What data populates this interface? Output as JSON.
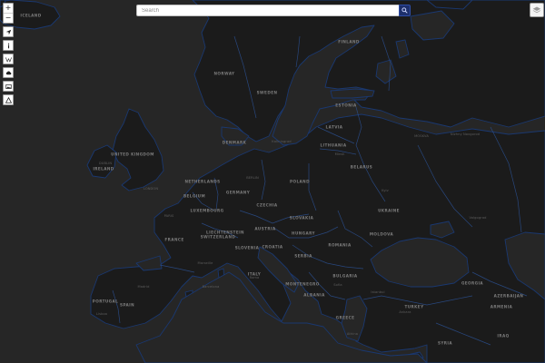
{
  "search": {
    "placeholder": "Search"
  },
  "toolbar": {
    "zoom_in": "+",
    "zoom_out": "−",
    "buttons": [
      {
        "icon": "navigation-arrow-icon"
      },
      {
        "icon": "info-icon"
      },
      {
        "icon": "wikipedia-icon"
      },
      {
        "icon": "weather-cloud-icon"
      },
      {
        "icon": "image-icon"
      },
      {
        "icon": "triangle-warning-icon"
      }
    ]
  },
  "layers": {
    "icon": "layers-icon"
  },
  "colors": {
    "land": "#1b1b1b",
    "sea": "#262626",
    "border": "#2b4f8f",
    "coast": "#1a3870",
    "accent": "#1d2f6b"
  },
  "map": {
    "labels": [
      {
        "text": "ICELAND",
        "kind": "country"
      },
      {
        "text": "FINLAND",
        "kind": "country"
      },
      {
        "text": "NORWAY",
        "kind": "country"
      },
      {
        "text": "SWEDEN",
        "kind": "country"
      },
      {
        "text": "ESTONIA",
        "kind": "country"
      },
      {
        "text": "LATVIA",
        "kind": "country"
      },
      {
        "text": "LITHUANIA",
        "kind": "country"
      },
      {
        "text": "UNITED KINGDOM",
        "kind": "country"
      },
      {
        "text": "IRELAND",
        "kind": "country"
      },
      {
        "text": "DENMARK",
        "kind": "country"
      },
      {
        "text": "POLAND",
        "kind": "country"
      },
      {
        "text": "BELARUS",
        "kind": "country"
      },
      {
        "text": "GERMANY",
        "kind": "country"
      },
      {
        "text": "NETHERLANDS",
        "kind": "country"
      },
      {
        "text": "BELGIUM",
        "kind": "country"
      },
      {
        "text": "LUXEMBOURG",
        "kind": "country"
      },
      {
        "text": "FRANCE",
        "kind": "country"
      },
      {
        "text": "SWITZERLAND",
        "kind": "country"
      },
      {
        "text": "LIECHTENSTEIN",
        "kind": "country"
      },
      {
        "text": "AUSTRIA",
        "kind": "country"
      },
      {
        "text": "CZECHIA",
        "kind": "country"
      },
      {
        "text": "SLOVAKIA",
        "kind": "country"
      },
      {
        "text": "HUNGARY",
        "kind": "country"
      },
      {
        "text": "SLOVENIA",
        "kind": "country"
      },
      {
        "text": "CROATIA",
        "kind": "country"
      },
      {
        "text": "ROMANIA",
        "kind": "country"
      },
      {
        "text": "MOLDOVA",
        "kind": "country"
      },
      {
        "text": "UKRAINE",
        "kind": "country"
      },
      {
        "text": "SERBIA",
        "kind": "country"
      },
      {
        "text": "BULGARIA",
        "kind": "country"
      },
      {
        "text": "ITALY",
        "kind": "country"
      },
      {
        "text": "SPAIN",
        "kind": "country"
      },
      {
        "text": "PORTUGAL",
        "kind": "country"
      },
      {
        "text": "MONTENEGRO",
        "kind": "country"
      },
      {
        "text": "ALBANIA",
        "kind": "country"
      },
      {
        "text": "GREECE",
        "kind": "country"
      },
      {
        "text": "TURKEY",
        "kind": "country"
      },
      {
        "text": "GEORGIA",
        "kind": "country"
      },
      {
        "text": "AZERBAIJAN",
        "kind": "country"
      },
      {
        "text": "ARMENIA",
        "kind": "country"
      },
      {
        "text": "SYRIA",
        "kind": "country"
      },
      {
        "text": "IRAQ",
        "kind": "country"
      },
      {
        "text": "LONDON",
        "kind": "city"
      },
      {
        "text": "DUBLIN",
        "kind": "city"
      },
      {
        "text": "PARIS",
        "kind": "city"
      },
      {
        "text": "BERLIN",
        "kind": "city"
      },
      {
        "text": "MOSKVA",
        "kind": "city"
      },
      {
        "text": "Nizhny Novgorod",
        "kind": "city"
      },
      {
        "text": "Kaliningrad",
        "kind": "city"
      },
      {
        "text": "Minsk",
        "kind": "city"
      },
      {
        "text": "Kyiv",
        "kind": "city"
      },
      {
        "text": "Volgograd",
        "kind": "city"
      },
      {
        "text": "Marseille",
        "kind": "city"
      },
      {
        "text": "Barcelona",
        "kind": "city"
      },
      {
        "text": "Madrid",
        "kind": "city"
      },
      {
        "text": "Lisboa",
        "kind": "city"
      },
      {
        "text": "Roma",
        "kind": "city"
      },
      {
        "text": "Sofia",
        "kind": "city"
      },
      {
        "text": "Istanbul",
        "kind": "city"
      },
      {
        "text": "Ankara",
        "kind": "city"
      },
      {
        "text": "Athina",
        "kind": "city"
      }
    ]
  }
}
